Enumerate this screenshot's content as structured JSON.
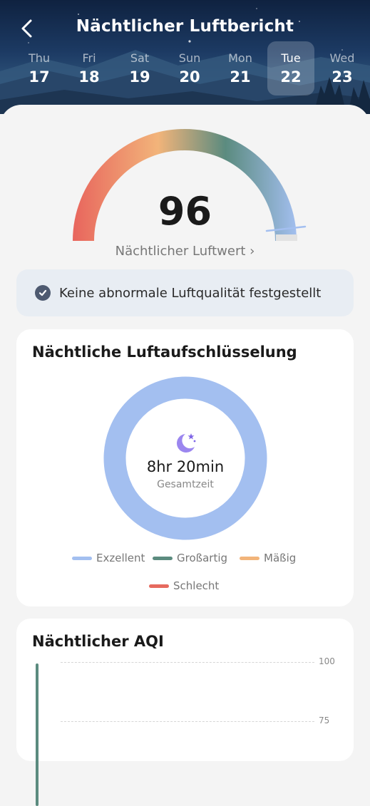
{
  "header": {
    "title": "Nächtlicher Luftbericht",
    "back_icon": "back-chevron-icon",
    "days": [
      {
        "name": "Thu",
        "num": "17"
      },
      {
        "name": "Fri",
        "num": "18"
      },
      {
        "name": "Sat",
        "num": "19"
      },
      {
        "name": "Sun",
        "num": "20"
      },
      {
        "name": "Mon",
        "num": "21"
      },
      {
        "name": "Tue",
        "num": "22",
        "selected": true
      },
      {
        "name": "Wed",
        "num": "23"
      }
    ]
  },
  "score": {
    "value": "96",
    "link_label": "Nächtlicher Luftwert ›",
    "gauge_fraction": 0.96
  },
  "status": {
    "icon": "check-circle-icon",
    "text": "Keine abnormale Luftqualität festgestellt"
  },
  "breakdown": {
    "title": "Nächtliche Luftaufschlüsselung",
    "icon": "moon-stars-icon",
    "total": "8hr 20min",
    "total_label": "Gesamtzeit",
    "legend": [
      {
        "label": "Exzellent",
        "color": "#a3bff0"
      },
      {
        "label": "Großartig",
        "color": "#5b8b7f"
      },
      {
        "label": "Mäßig",
        "color": "#f2b47a"
      },
      {
        "label": "Schlecht",
        "color": "#e66a5e"
      }
    ]
  },
  "aqi": {
    "title": "Nächtlicher AQI",
    "axis_labels": [
      "100",
      "75"
    ]
  }
}
